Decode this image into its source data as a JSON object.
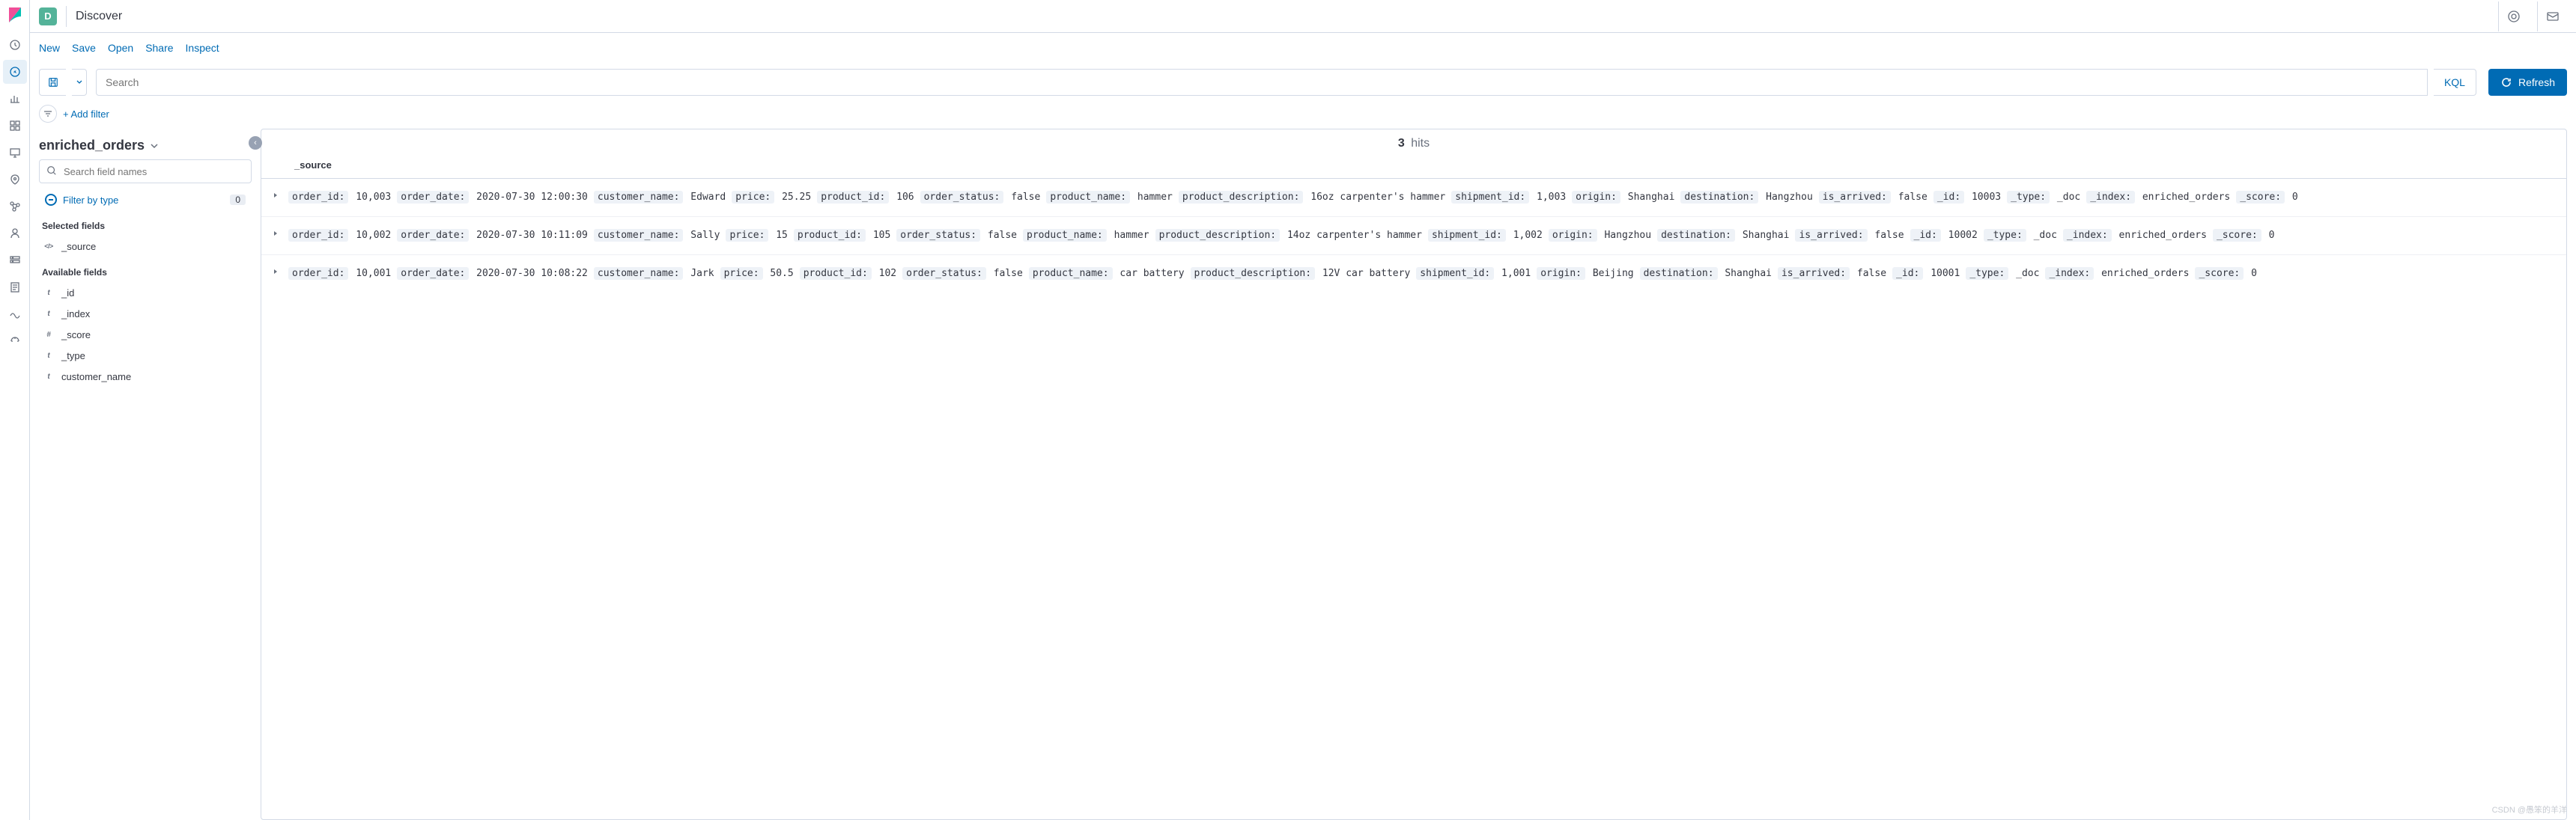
{
  "header": {
    "badge_letter": "D",
    "title": "Discover"
  },
  "toolbar": {
    "new": "New",
    "save": "Save",
    "open": "Open",
    "share": "Share",
    "inspect": "Inspect"
  },
  "search": {
    "placeholder": "Search",
    "kql_label": "KQL",
    "refresh_label": "Refresh"
  },
  "filter_row": {
    "add_filter": "+ Add filter"
  },
  "sidebar": {
    "index_pattern": "enriched_orders",
    "field_search_placeholder": "Search field names",
    "filter_by_type": "Filter by type",
    "filter_badge": "0",
    "selected_title": "Selected fields",
    "available_title": "Available fields",
    "selected_fields": [
      {
        "type": "src",
        "name": "_source"
      }
    ],
    "available_fields": [
      {
        "type": "t",
        "name": "_id"
      },
      {
        "type": "t",
        "name": "_index"
      },
      {
        "type": "#",
        "name": "_score"
      },
      {
        "type": "t",
        "name": "_type"
      },
      {
        "type": "t",
        "name": "customer_name"
      }
    ]
  },
  "results": {
    "hits_count": "3",
    "hits_label": "hits",
    "source_col": "_source",
    "documents": [
      {
        "pairs": [
          {
            "k": "order_id:",
            "v": "10,003"
          },
          {
            "k": "order_date:",
            "v": "2020-07-30 12:00:30"
          },
          {
            "k": "customer_name:",
            "v": "Edward"
          },
          {
            "k": "price:",
            "v": "25.25"
          },
          {
            "k": "product_id:",
            "v": "106"
          },
          {
            "k": "order_status:",
            "v": "false"
          },
          {
            "k": "product_name:",
            "v": "hammer"
          },
          {
            "k": "product_description:",
            "v": "16oz carpenter's hammer"
          },
          {
            "k": "shipment_id:",
            "v": "1,003"
          },
          {
            "k": "origin:",
            "v": "Shanghai"
          },
          {
            "k": "destination:",
            "v": "Hangzhou"
          },
          {
            "k": "is_arrived:",
            "v": "false"
          },
          {
            "k": "_id:",
            "v": "10003"
          },
          {
            "k": "_type:",
            "v": "_doc"
          },
          {
            "k": "_index:",
            "v": "enriched_orders"
          },
          {
            "k": "_score:",
            "v": "0"
          }
        ]
      },
      {
        "pairs": [
          {
            "k": "order_id:",
            "v": "10,002"
          },
          {
            "k": "order_date:",
            "v": "2020-07-30 10:11:09"
          },
          {
            "k": "customer_name:",
            "v": "Sally"
          },
          {
            "k": "price:",
            "v": "15"
          },
          {
            "k": "product_id:",
            "v": "105"
          },
          {
            "k": "order_status:",
            "v": "false"
          },
          {
            "k": "product_name:",
            "v": "hammer"
          },
          {
            "k": "product_description:",
            "v": "14oz carpenter's hammer"
          },
          {
            "k": "shipment_id:",
            "v": "1,002"
          },
          {
            "k": "origin:",
            "v": "Hangzhou"
          },
          {
            "k": "destination:",
            "v": "Shanghai"
          },
          {
            "k": "is_arrived:",
            "v": "false"
          },
          {
            "k": "_id:",
            "v": "10002"
          },
          {
            "k": "_type:",
            "v": "_doc"
          },
          {
            "k": "_index:",
            "v": "enriched_orders"
          },
          {
            "k": "_score:",
            "v": "0"
          }
        ]
      },
      {
        "pairs": [
          {
            "k": "order_id:",
            "v": "10,001"
          },
          {
            "k": "order_date:",
            "v": "2020-07-30 10:08:22"
          },
          {
            "k": "customer_name:",
            "v": "Jark"
          },
          {
            "k": "price:",
            "v": "50.5"
          },
          {
            "k": "product_id:",
            "v": "102"
          },
          {
            "k": "order_status:",
            "v": "false"
          },
          {
            "k": "product_name:",
            "v": "car battery"
          },
          {
            "k": "product_description:",
            "v": "12V car battery"
          },
          {
            "k": "shipment_id:",
            "v": "1,001"
          },
          {
            "k": "origin:",
            "v": "Beijing"
          },
          {
            "k": "destination:",
            "v": "Shanghai"
          },
          {
            "k": "is_arrived:",
            "v": "false"
          },
          {
            "k": "_id:",
            "v": "10001"
          },
          {
            "k": "_type:",
            "v": "_doc"
          },
          {
            "k": "_index:",
            "v": "enriched_orders"
          },
          {
            "k": "_score:",
            "v": "0"
          }
        ]
      }
    ]
  },
  "watermark": "CSDN @愚笨的羊洋"
}
